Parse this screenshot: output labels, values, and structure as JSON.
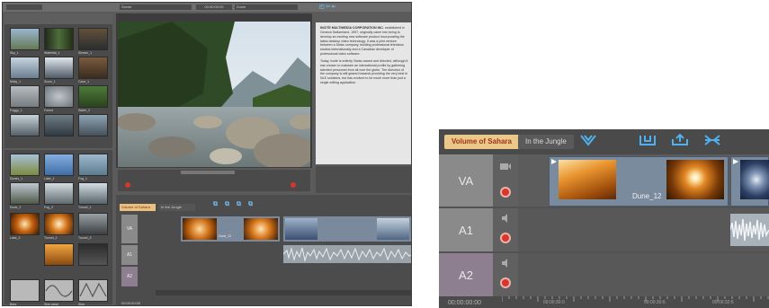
{
  "left": {
    "top_field": "Scene",
    "time_field": "00:00:00:00",
    "zoom_field": "Zoom",
    "thumbnails": [
      "Sky_1",
      "Waterfall_1",
      "Stream_1",
      "Misty_1",
      "Snow_1",
      "Cave_1",
      "Foggy_1",
      "Forest",
      "Water_2",
      "Dunes_1",
      "Lake_1",
      "Fog_1",
      "Dune_2",
      "Fog_3",
      "Tunnel_1",
      "Lake_3",
      "Tunnel_2",
      "Tunnel_3",
      "Bars",
      "Sine wave",
      "Sine"
    ],
    "article": {
      "title": "INCITE MULTIMEDIA CORPORATION INC.",
      "p1": "established in Geneva Switzerland, 1997, originally came into being to develop an exciting new software product incorporating the latest desktop video technology. It was a joint venture between a Swiss company, building professional television studios internationally and a Canadian developer of professional video software.",
      "p2": "Today, Incite is entirely Swiss owned and directed, although it has chosen to maintain an international profile by gathering talented personnel from all over the globe. The direction of the company is still geared towards providing the very best in NLE solutions, but has evolved to be much more than just a single editing application."
    },
    "timeline": {
      "tabs": [
        "Volume of Sahara",
        "In the Jungle"
      ],
      "tracks": [
        "VA",
        "A1",
        "A2"
      ],
      "clip_label": "Dune_12",
      "time": "00:00:00:00",
      "transport_labels": [
        "Edit",
        "Subclip",
        "Save",
        "Search"
      ]
    }
  },
  "right": {
    "tabs": [
      "Volume of Sahara",
      "In the Jungle"
    ],
    "tracks": [
      "VA",
      "A1",
      "A2"
    ],
    "clip_label": "Dune_12",
    "timecode": "00:00:00:00",
    "ruler_labels": [
      "00:00:30:0",
      "00:00:30:6",
      "00:00:32:6"
    ]
  }
}
